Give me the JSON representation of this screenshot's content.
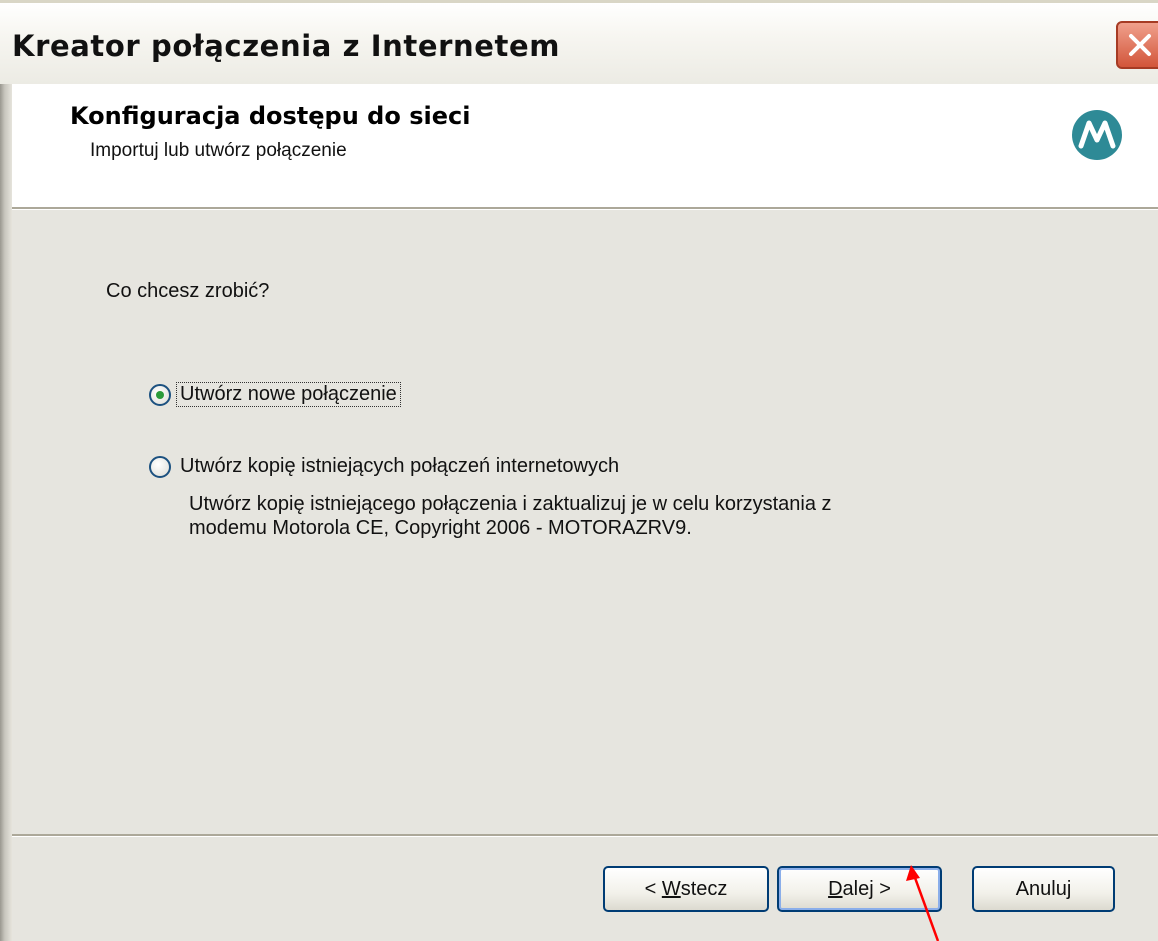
{
  "window": {
    "title": "Kreator połączenia z Internetem"
  },
  "header": {
    "title": "Konfiguracja dostępu do sieci",
    "subtitle": "Importuj lub utwórz połączenie",
    "logo_icon": "motorola-logo-icon",
    "logo_color": "#2e8a96"
  },
  "content": {
    "question": "Co chcesz zrobić?",
    "options": [
      {
        "label": "Utwórz nowe połączenie",
        "checked": true
      },
      {
        "label": "Utwórz kopię istniejących połączeń internetowych",
        "checked": false
      }
    ],
    "option2_description_line1": "Utwórz kopię istniejącego połączenia i zaktualizuj je w celu korzystania z",
    "option2_description_line2": "modemu Motorola CE, Copyright 2006 - MOTORAZRV9."
  },
  "footer": {
    "back_prefix": "< ",
    "back_mnemonic": "W",
    "back_rest": "stecz",
    "next_mnemonic": "D",
    "next_rest": "alej >",
    "cancel_label": "Anuluj"
  },
  "colors": {
    "annotation_arrow": "#ff0000",
    "close_button": "#d2553a",
    "radio_selected": "#2a9a3a"
  }
}
